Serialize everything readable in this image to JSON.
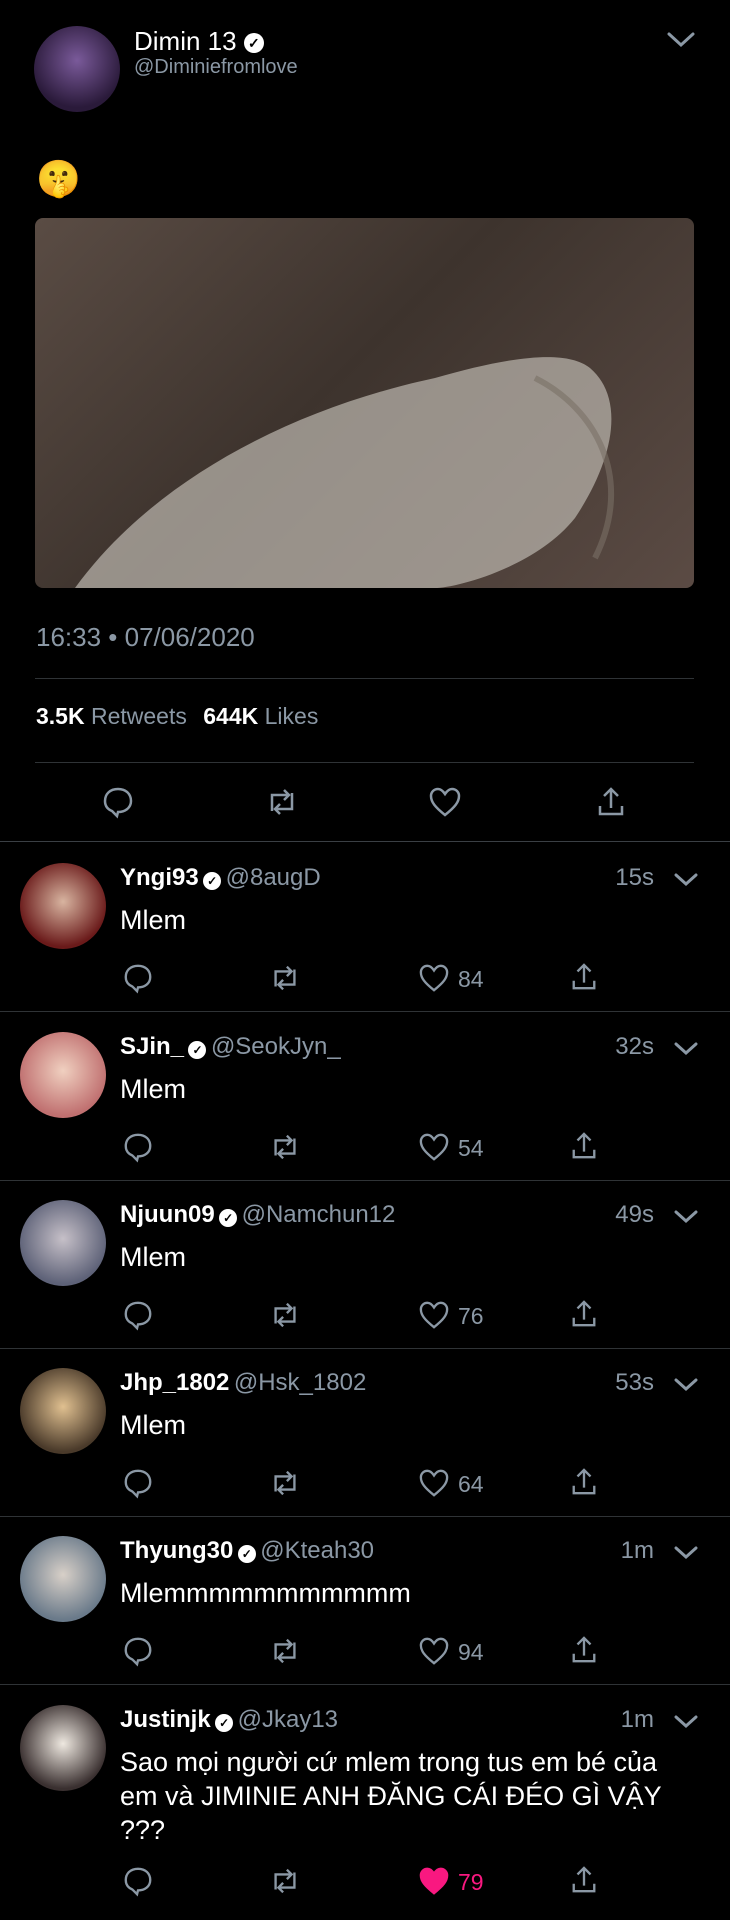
{
  "tweet": {
    "author_name": "Dimin 13",
    "author_handle": "@Diminiefromlove",
    "emoji": "🤫",
    "timestamp": "16:33 • 07/06/2020",
    "retweets_count": "3.5K",
    "retweets_label": "Retweets",
    "likes_count": "644K",
    "likes_label": "Likes"
  },
  "replies": [
    {
      "name": "Yngi93",
      "verified": true,
      "handle": "@8augD",
      "time": "15s",
      "text": "Mlem",
      "likes": "84",
      "liked": false
    },
    {
      "name": "SJin_",
      "verified": true,
      "handle": "@SeokJyn_",
      "time": "32s",
      "text": "Mlem",
      "likes": "54",
      "liked": false
    },
    {
      "name": "Njuun09",
      "verified": true,
      "handle": "@Namchun12",
      "time": "49s",
      "text": "Mlem",
      "likes": "76",
      "liked": false
    },
    {
      "name": "Jhp_1802",
      "verified": false,
      "handle": "@Hsk_1802",
      "time": "53s",
      "text": "Mlem",
      "likes": "64",
      "liked": false
    },
    {
      "name": "Thyung30",
      "verified": true,
      "handle": "@Kteah30",
      "time": "1m",
      "text": "Mlemmmmmmmmmmm",
      "likes": "94",
      "liked": false
    },
    {
      "name": "Justinjk",
      "verified": true,
      "handle": "@Jkay13",
      "time": "1m",
      "text": "Sao mọi người cứ mlem trong tus em bé của em và JIMINIE ANH ĐĂNG CÁI ĐÉO GÌ VẬY ???",
      "likes": "79",
      "liked": true
    }
  ],
  "colors": {
    "background": "#000000",
    "secondary_text": "#8b98a5",
    "divider": "#2f3336",
    "like_red": "#f91880"
  }
}
